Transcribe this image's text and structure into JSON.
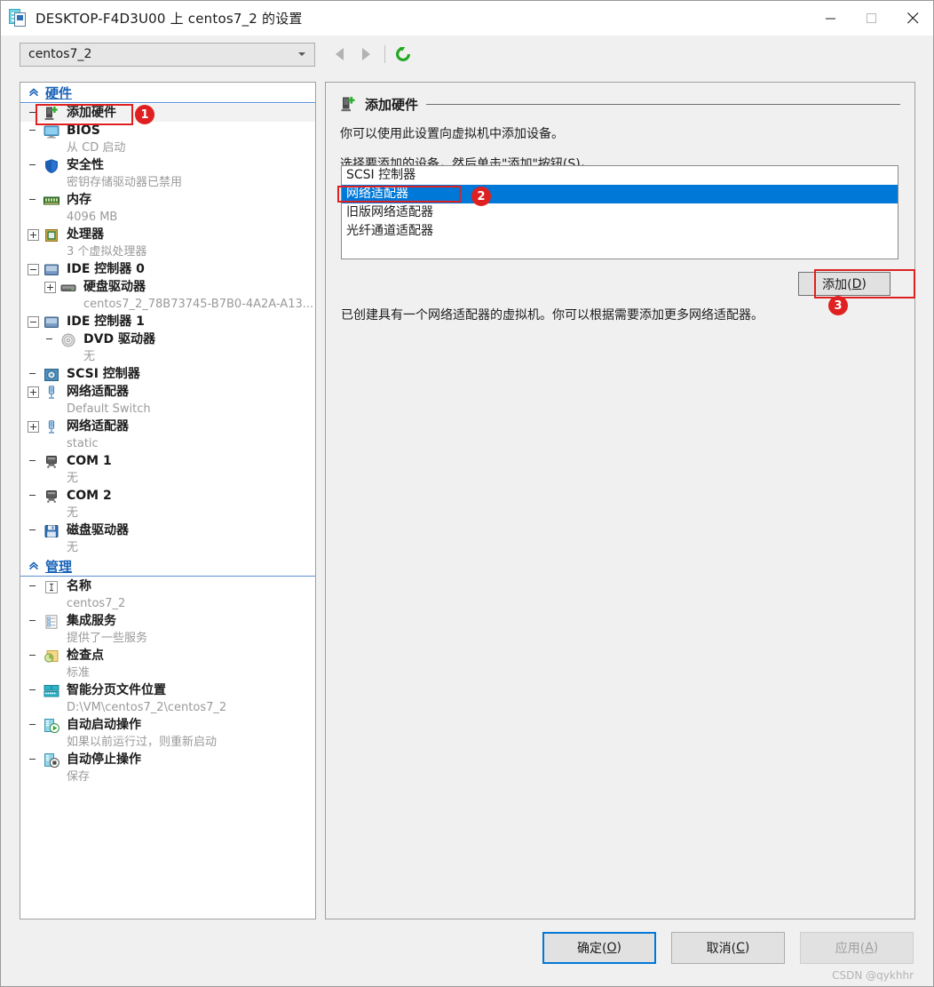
{
  "window": {
    "title": "DESKTOP-F4D3U00 上 centos7_2 的设置",
    "icon": "settings-vm-icon",
    "minimize_label": "─",
    "maximize_label": "□",
    "close_label": "✕"
  },
  "toolbar": {
    "vm_selector_value": "centos7_2",
    "back_icon": "arrow-left-icon",
    "forward_icon": "arrow-right-icon",
    "refresh_icon": "refresh-icon"
  },
  "sidebar": {
    "sections": [
      {
        "title": "硬件",
        "chevron_icon": "chevron-double-up-icon",
        "items": [
          {
            "icon": "add-hardware-icon",
            "label": "添加硬件",
            "sub": "",
            "indent": 0,
            "expander": "none",
            "selected": true
          },
          {
            "icon": "bios-monitor-icon",
            "label": "BIOS",
            "sub": "从 CD 启动",
            "indent": 0,
            "expander": "none",
            "selected": false
          },
          {
            "icon": "security-shield-icon",
            "label": "安全性",
            "sub": "密钥存储驱动器已禁用",
            "indent": 0,
            "expander": "none",
            "selected": false
          },
          {
            "icon": "memory-chip-icon",
            "label": "内存",
            "sub": "4096 MB",
            "indent": 0,
            "expander": "none",
            "selected": false
          },
          {
            "icon": "processor-icon",
            "label": "处理器",
            "sub": "3 个虚拟处理器",
            "indent": 0,
            "expander": "plus",
            "selected": false
          },
          {
            "icon": "ide-controller-icon",
            "label": "IDE 控制器 0",
            "sub": "",
            "indent": 0,
            "expander": "minus",
            "selected": false
          },
          {
            "icon": "hard-drive-icon",
            "label": "硬盘驱动器",
            "sub": "centos7_2_78B73745-B7B0-4A2A-A13...",
            "indent": 1,
            "expander": "plus",
            "selected": false
          },
          {
            "icon": "ide-controller-icon",
            "label": "IDE 控制器 1",
            "sub": "",
            "indent": 0,
            "expander": "minus",
            "selected": false
          },
          {
            "icon": "dvd-drive-icon",
            "label": "DVD 驱动器",
            "sub": "无",
            "indent": 1,
            "expander": "none",
            "selected": false
          },
          {
            "icon": "scsi-controller-icon",
            "label": "SCSI 控制器",
            "sub": "",
            "indent": 0,
            "expander": "none",
            "selected": false
          },
          {
            "icon": "network-adapter-icon",
            "label": "网络适配器",
            "sub": "Default Switch",
            "indent": 0,
            "expander": "plus",
            "selected": false
          },
          {
            "icon": "network-adapter-icon",
            "label": "网络适配器",
            "sub": "static",
            "indent": 0,
            "expander": "plus",
            "selected": false
          },
          {
            "icon": "com-port-icon",
            "label": "COM 1",
            "sub": "无",
            "indent": 0,
            "expander": "none",
            "selected": false
          },
          {
            "icon": "com-port-icon",
            "label": "COM 2",
            "sub": "无",
            "indent": 0,
            "expander": "none",
            "selected": false
          },
          {
            "icon": "floppy-drive-icon",
            "label": "磁盘驱动器",
            "sub": "无",
            "indent": 0,
            "expander": "none",
            "selected": false
          }
        ]
      },
      {
        "title": "管理",
        "chevron_icon": "chevron-double-up-icon",
        "items": [
          {
            "icon": "name-textbox-icon",
            "label": "名称",
            "sub": "centos7_2",
            "indent": 0,
            "expander": "none",
            "selected": false
          },
          {
            "icon": "integration-services-icon",
            "label": "集成服务",
            "sub": "提供了一些服务",
            "indent": 0,
            "expander": "none",
            "selected": false
          },
          {
            "icon": "checkpoint-icon",
            "label": "检查点",
            "sub": "标准",
            "indent": 0,
            "expander": "none",
            "selected": false
          },
          {
            "icon": "smart-paging-icon",
            "label": "智能分页文件位置",
            "sub": "D:\\VM\\centos7_2\\centos7_2",
            "indent": 0,
            "expander": "none",
            "selected": false
          },
          {
            "icon": "auto-start-icon",
            "label": "自动启动操作",
            "sub": "如果以前运行过，则重新启动",
            "indent": 0,
            "expander": "none",
            "selected": false
          },
          {
            "icon": "auto-stop-icon",
            "label": "自动停止操作",
            "sub": "保存",
            "indent": 0,
            "expander": "none",
            "selected": false
          }
        ]
      }
    ]
  },
  "main": {
    "header_icon": "add-hardware-icon",
    "header_title": "添加硬件",
    "paragraph_1": "你可以使用此设置向虚拟机中添加设备。",
    "paragraph_2_prefix": "选择要添加的设备，然后单击\"添加\"按钮(",
    "paragraph_2_accel": "S",
    "paragraph_2_suffix": ")。",
    "device_list": [
      {
        "label": "SCSI 控制器",
        "selected": false
      },
      {
        "label": "网络适配器",
        "selected": true
      },
      {
        "label": "旧版网络适配器",
        "selected": false
      },
      {
        "label": "光纤通道适配器",
        "selected": false
      }
    ],
    "add_button_label": "添加(",
    "add_button_accel": "D",
    "add_button_suffix": ")",
    "footnote": "已创建具有一个网络适配器的虚拟机。你可以根据需要添加更多网络适配器。"
  },
  "footer": {
    "ok_label": "确定(",
    "ok_accel": "O",
    "ok_suffix": ")",
    "cancel_label": "取消(",
    "cancel_accel": "C",
    "cancel_suffix": ")",
    "apply_label": "应用(",
    "apply_accel": "A",
    "apply_suffix": ")",
    "watermark": "CSDN @qykhhr"
  },
  "annotations": [
    {
      "number": "1"
    },
    {
      "number": "2"
    },
    {
      "number": "3"
    }
  ],
  "colors": {
    "accent_blue": "#0078d7",
    "section_header_blue": "#1a63b8",
    "annotation_red": "#e02020",
    "refresh_green": "#21a821"
  }
}
